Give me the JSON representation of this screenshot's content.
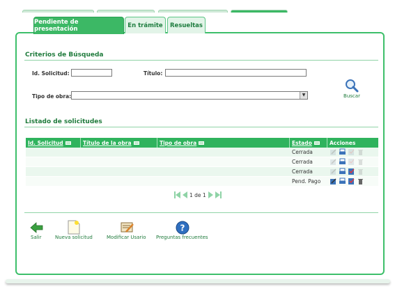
{
  "tabs": [
    {
      "label": "Pendiente de presentación",
      "active": true
    },
    {
      "label": "En trámite",
      "active": false
    },
    {
      "label": "Resueltas",
      "active": false
    }
  ],
  "search": {
    "title": "Criterios de Búsqueda",
    "id_label": "Id. Solicitud:",
    "id_value": "",
    "titulo_label": "Título:",
    "titulo_value": "",
    "tipo_label": "Tipo de obra:",
    "tipo_value": "",
    "button_label": "Buscar"
  },
  "listing": {
    "title": "Listado de solicitudes",
    "columns": [
      "Id. Solicitud",
      "Título de la obra",
      "Tipo de obra",
      "Estado",
      "Acciones"
    ],
    "rows": [
      {
        "id": "",
        "titulo": "",
        "tipo": "",
        "estado": "Cerrada"
      },
      {
        "id": "",
        "titulo": "",
        "tipo": "",
        "estado": "Cerrada"
      },
      {
        "id": "",
        "titulo": "",
        "tipo": "",
        "estado": "Cerrada"
      },
      {
        "id": "",
        "titulo": "",
        "tipo": "",
        "estado": "Pend. Pago"
      }
    ],
    "pager": "1 de 1"
  },
  "footer": {
    "salir": "Salir",
    "nueva": "Nueva solicitud",
    "modificar": "Modificar Usario",
    "preguntas": "Preguntas frecuentes"
  },
  "colors": {
    "accent": "#3cb865",
    "header": "#2fb35d",
    "title": "#1f7b3c"
  }
}
